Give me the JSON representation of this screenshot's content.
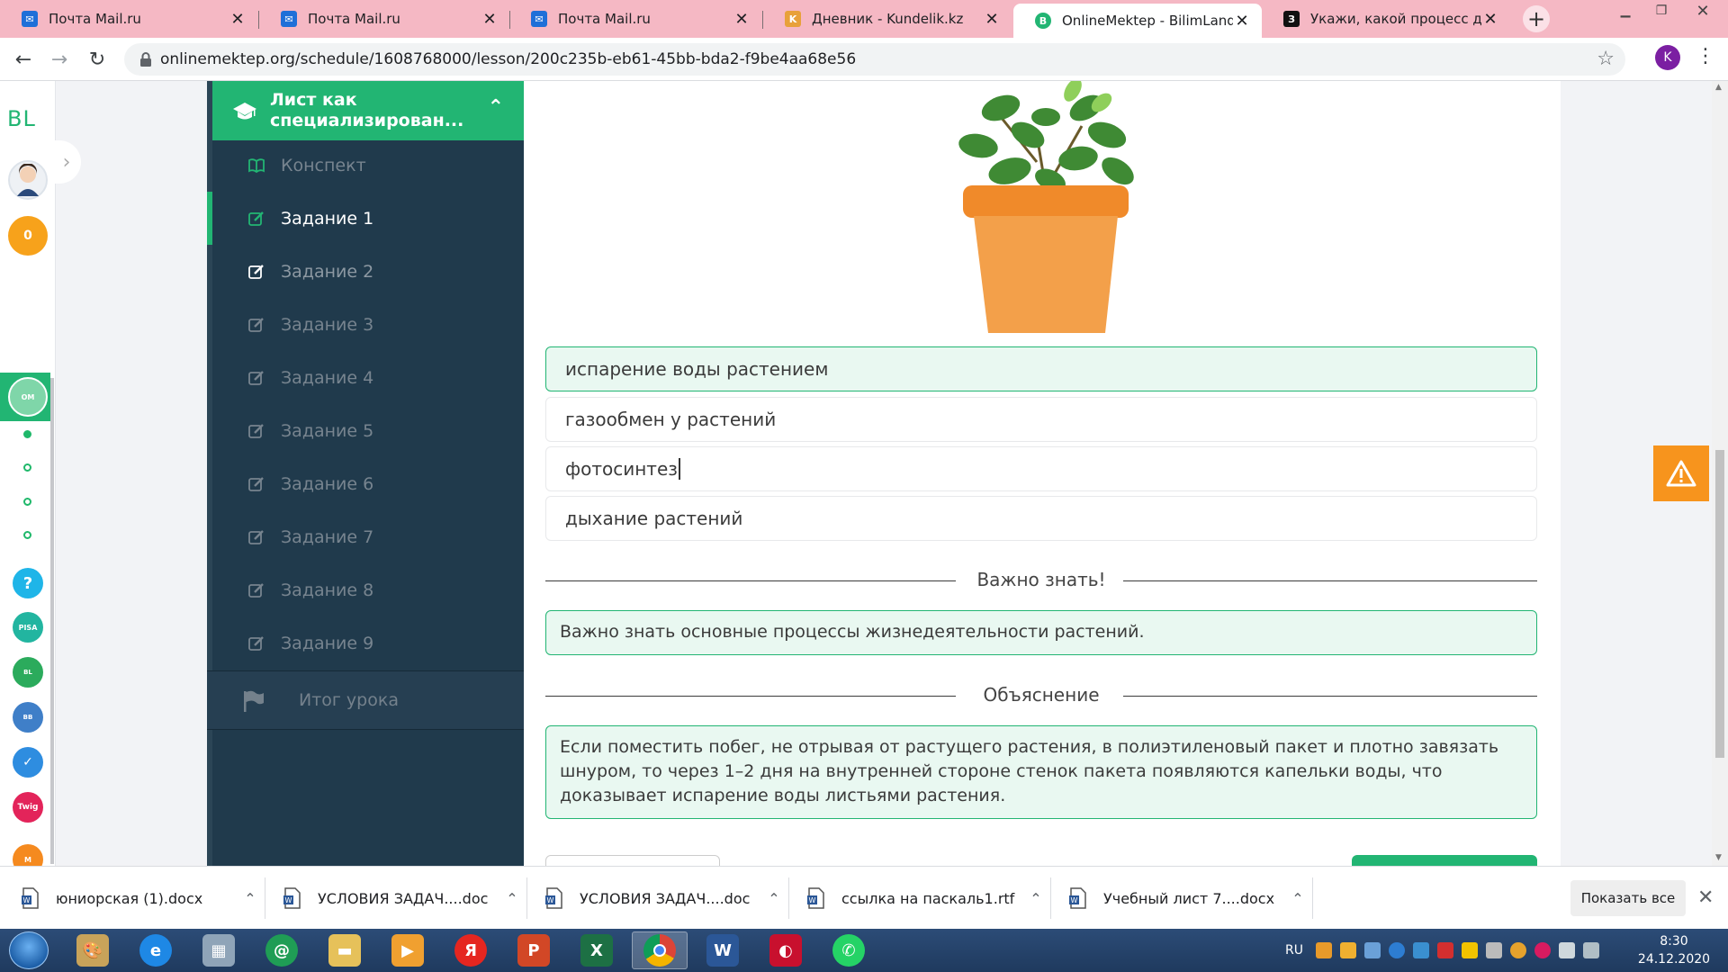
{
  "browser": {
    "tabs": [
      {
        "title": "Почта Mail.ru",
        "icon": "mail-icon",
        "color": "#1f6fd8"
      },
      {
        "title": "Почта Mail.ru",
        "icon": "mail-icon",
        "color": "#1f6fd8"
      },
      {
        "title": "Почта Mail.ru",
        "icon": "mail-icon",
        "color": "#1f6fd8"
      },
      {
        "title": "Дневник - Kundelik.kz",
        "icon": "kundelik-icon",
        "color": "#e8a13a"
      },
      {
        "title": "OnlineMektep - BilimLand",
        "icon": "bilimland-icon",
        "color": "#22b573"
      },
      {
        "title": "Укажи, какой процесс демо",
        "icon": "znanija-icon",
        "color": "#111111"
      }
    ],
    "active_tab": 4,
    "url": "onlinemektep.org/schedule/1608768000/lesson/200c235b-eb61-45bb-bda2-f9be4aa68e56",
    "profile_initial": "K"
  },
  "rail": {
    "logo": "BL",
    "coins": "0",
    "help": "?"
  },
  "sidebar": {
    "section_title_line1": "Лист как",
    "section_title_line2": "специализирован...",
    "items": [
      {
        "label": "Конспект",
        "icon": "book-icon",
        "active": false
      },
      {
        "label": "Задание 1",
        "icon": "edit-icon",
        "active": true
      },
      {
        "label": "Задание 2",
        "icon": "edit-icon",
        "active": false
      },
      {
        "label": "Задание 3",
        "icon": "edit-icon",
        "active": false
      },
      {
        "label": "Задание 4",
        "icon": "edit-icon",
        "active": false
      },
      {
        "label": "Задание 5",
        "icon": "edit-icon",
        "active": false
      },
      {
        "label": "Задание 6",
        "icon": "edit-icon",
        "active": false
      },
      {
        "label": "Задание 7",
        "icon": "edit-icon",
        "active": false
      },
      {
        "label": "Задание 8",
        "icon": "edit-icon",
        "active": false
      },
      {
        "label": "Задание 9",
        "icon": "edit-icon",
        "active": false
      }
    ],
    "final_label": "Итог урока"
  },
  "quiz": {
    "options": [
      {
        "text": "испарение воды растением",
        "correct": true
      },
      {
        "text": "газообмен у растений",
        "correct": false
      },
      {
        "text": "фотосинтез",
        "correct": false
      },
      {
        "text": "дыхание растений",
        "correct": false
      }
    ],
    "important_heading": "Важно знать!",
    "important_text": "Важно знать основные процессы жизнедеятельности растений.",
    "explanation_heading": "Объяснение",
    "explanation_text": "Если поместить побег, не отрывая от растущего растения, в полиэтиленовый пакет и плотно завязать шнуром, то через 1–2 дня на внутренней стороне стенок пакета появляются капельки воды, что доказывает испарение воды листьями растения."
  },
  "downloads": {
    "items": [
      "юниорская (1).docx",
      "УСЛОВИЯ ЗАДАЧ....doc",
      "УСЛОВИЯ ЗАДАЧ....doc",
      "ссылка на паскаль1.rtf",
      "Учебный лист 7....docx"
    ],
    "show_all": "Показать все"
  },
  "taskbar": {
    "language": "RU",
    "time": "8:30",
    "date": "24.12.2020"
  },
  "colors": {
    "accent_green": "#22b573",
    "sidebar_bg": "#203a4c",
    "warning_orange": "#f7941d"
  }
}
